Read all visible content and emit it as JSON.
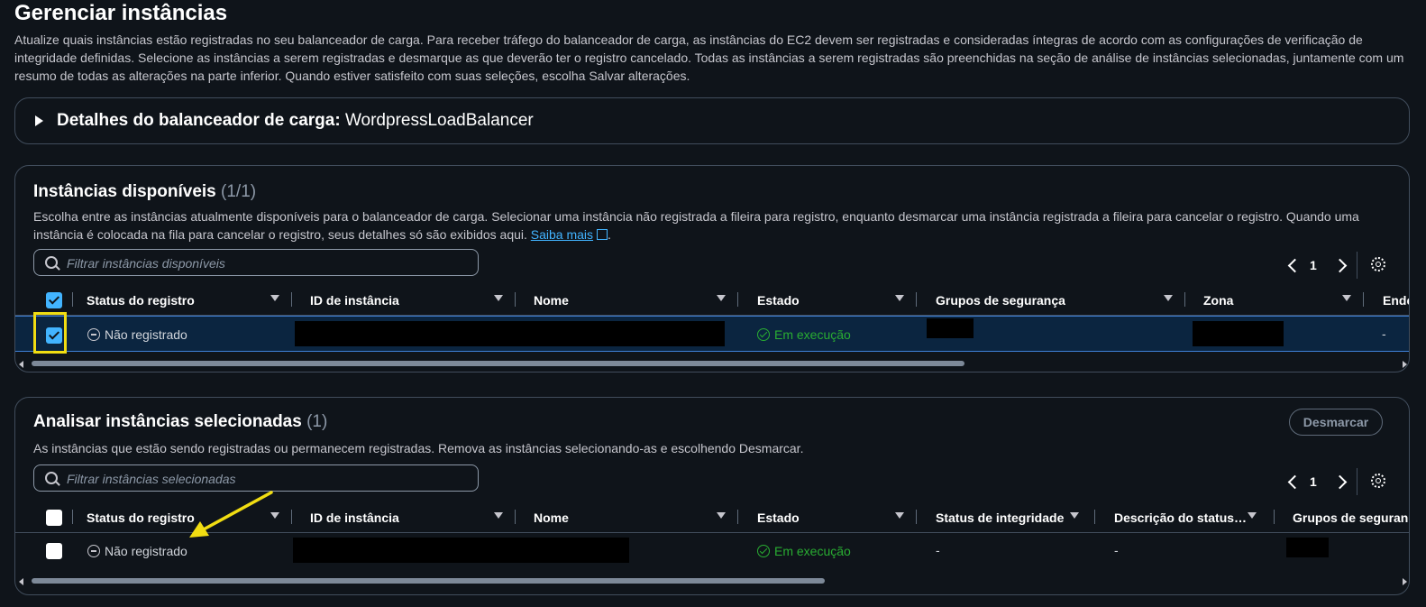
{
  "page": {
    "title": "Gerenciar instâncias",
    "description": "Atualize quais instâncias estão registradas no seu balanceador de carga. Para receber tráfego do balanceador de carga, as instâncias do EC2 devem ser registradas e consideradas íntegras de acordo com as configurações de verificação de integridade definidas. Selecione as instâncias a serem registradas e desmarque as que deverão ter o registro cancelado. Todas as instâncias a serem registradas são preenchidas na seção de análise de instâncias selecionadas, juntamente com um resumo de todas as alterações na parte inferior. Quando estiver satisfeito com suas seleções, escolha Salvar alterações."
  },
  "load_balancer": {
    "label": "Detalhes do balanceador de carga:",
    "name": "WordpressLoadBalancer"
  },
  "available": {
    "title": "Instâncias disponíveis",
    "count": "(1/1)",
    "description": "Escolha entre as instâncias atualmente disponíveis para o balanceador de carga. Selecionar uma instância não registrada a fileira para registro, enquanto desmarcar uma instância registrada a fileira para cancelar o registro. Quando uma instância é colocada na fila para cancelar o registro, seus detalhes só são exibidos aqui.",
    "learn_more": "Saiba mais",
    "filter_placeholder": "Filtrar instâncias disponíveis",
    "page": "1",
    "columns": [
      "Status do registro",
      "ID de instância",
      "Nome",
      "Estado",
      "Grupos de segurança",
      "Zona",
      "Ende"
    ],
    "row": {
      "status": "Não registrado",
      "state": "Em execução",
      "last": "-",
      "checked": true
    }
  },
  "review": {
    "title": "Analisar instâncias selecionadas",
    "count": "(1)",
    "description": "As instâncias que estão sendo registradas ou permanecem registradas. Remova as instâncias selecionando-as e escolhendo Desmarcar.",
    "deselect_label": "Desmarcar",
    "filter_placeholder": "Filtrar instâncias selecionadas",
    "page": "1",
    "columns": [
      "Status do registro",
      "ID de instância",
      "Nome",
      "Estado",
      "Status de integridade",
      "Descrição do status…",
      "Grupos de seguranç"
    ],
    "row": {
      "status": "Não registrado",
      "state": "Em execução",
      "health": "-",
      "status_desc": "-",
      "checked": false
    }
  },
  "colors": {
    "background": "#0f141a",
    "accent": "#42b4ff",
    "running": "#29ad32",
    "annotation": "#f1dd12"
  }
}
